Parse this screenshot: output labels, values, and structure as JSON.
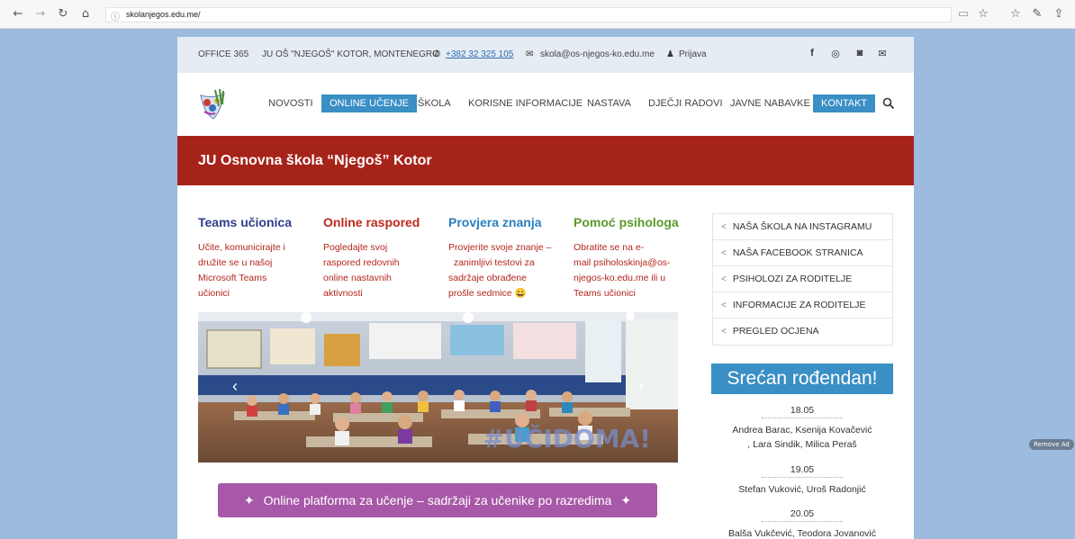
{
  "browser": {
    "url": "skolanjegos.edu.me/"
  },
  "topbar": {
    "office": "OFFICE 365",
    "school": "JU OŠ \"NJEGOŠ\" KOTOR, MONTENEGRO",
    "phone": "+382 32 325 105",
    "email": "skola@os-njegos-ko.edu.me",
    "login": "Prijava"
  },
  "menu": {
    "items": [
      "NOVOSTI",
      "ONLINE UČENJE",
      "ŠKOLA",
      "KORISNE INFORMACIJE",
      "NASTAVA",
      "DJEČJI RADOVI",
      "JAVNE NABAVKE",
      "KONTAKT"
    ]
  },
  "hero": {
    "title": "JU Osnovna škola “Njegoš” Kotor"
  },
  "columns": [
    {
      "title": "Teams učionica",
      "text_lines": [
        "Učite, komunicirajte i",
        "družite se u našoj",
        "Microsoft Teams",
        "učionici"
      ],
      "title_color": "#2c3e8c"
    },
    {
      "title": "Online raspored",
      "text_lines": [
        "Pogledajte svoj",
        "raspored redovnih",
        "online nastavnih",
        "aktivnosti"
      ],
      "title_color": "#c0281e"
    },
    {
      "title": "Provjera znanja",
      "text_lines": [
        "Provjerite svoje znanje –",
        "  zanimljivi testovi za",
        "sadržaje obrađene",
        "prošle sedmice 😀"
      ],
      "title_color": "#2a7fc0"
    },
    {
      "title": "Pomoć psihologa",
      "text_lines": [
        "Obratite se na e-",
        "mail psiholoskinja@os-",
        "njegos-ko.edu.me ili u",
        "Teams učionici"
      ],
      "title_color": "#5a9a2a"
    }
  ],
  "photo": {
    "caption": "#UČIDOMA!"
  },
  "platform_button": {
    "label": "Online platforma za učenje – sadržaji za učenike po razredima"
  },
  "sidebar": {
    "items": [
      "NAŠA ŠKOLA NA INSTAGRAMU",
      "NAŠA FACEBOOK STRANICA",
      "PSIHOLOZI ZA RODITELJE",
      "INFORMACIJE ZA RODITELJE",
      "PREGLED OCJENA"
    ]
  },
  "birthday": {
    "title": "Srećan rođendan!",
    "entries": [
      {
        "date": "18.05",
        "names": [
          "Andrea Barac, Ksenija Kovačević",
          ", Lara Sindik, Milica Peraš"
        ]
      },
      {
        "date": "19.05",
        "names": [
          "Stefan Vuković, Uroš Radonjić"
        ]
      },
      {
        "date": "20.05",
        "names": [
          "Balša Vukčević, Teodora Jovanović"
        ]
      }
    ]
  },
  "ad": {
    "label": "Remove Ad"
  },
  "colors": {
    "accent_blue": "#3a8fc4",
    "hero_red": "#a6231a",
    "purple": "#a858a8",
    "page_bg": "#9dbadf"
  }
}
